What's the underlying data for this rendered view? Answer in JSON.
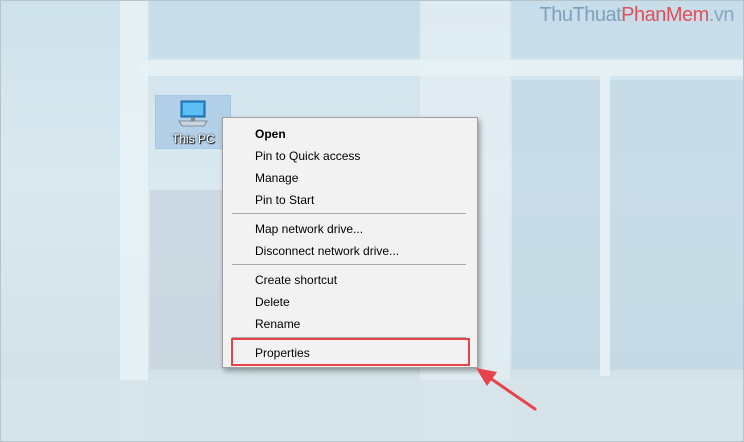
{
  "watermark": {
    "part1": "Thu",
    "part2": "Thuat",
    "part3": "PhanMem",
    "part4": ".vn"
  },
  "desktop_icon": {
    "label": "This PC",
    "icon": "computer-monitor-icon"
  },
  "context_menu": {
    "items": [
      {
        "label": "Open",
        "default": true
      },
      {
        "label": "Pin to Quick access"
      },
      {
        "label": "Manage"
      },
      {
        "label": "Pin to Start"
      },
      {
        "label": "Map network drive..."
      },
      {
        "label": "Disconnect network drive..."
      },
      {
        "label": "Create shortcut"
      },
      {
        "label": "Delete"
      },
      {
        "label": "Rename"
      },
      {
        "label": "Properties"
      }
    ],
    "highlighted_item": "Properties"
  },
  "colors": {
    "highlight": "#e8434a",
    "menu_bg": "#f2f2f2",
    "desktop": "#cfe2ea"
  }
}
